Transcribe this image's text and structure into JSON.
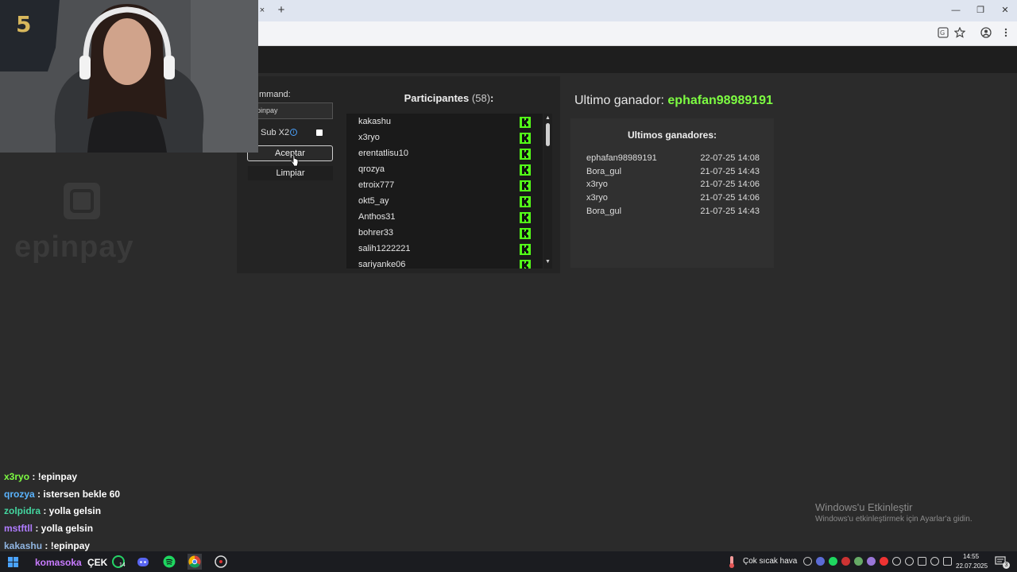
{
  "browser": {
    "tab_close": "×",
    "new_tab": "+",
    "window_controls": {
      "minimize": "—",
      "restore": "❐",
      "close": "✕"
    },
    "toolbar_icons": [
      "translate-icon",
      "star-icon",
      "profile-icon",
      "menu-icon"
    ]
  },
  "raffle": {
    "command_label": "mmand:",
    "command_value": "pinpay",
    "sub_label": "Sub X2",
    "sub_checked": false,
    "accept_label": "Aceptar",
    "clear_label": "Limpiar"
  },
  "participants": {
    "title": "Participantes",
    "count_text": "(58)",
    "colon": ":",
    "names": [
      "kakashu",
      "x3ryo",
      "erentatlisu10",
      "qrozya",
      "etroix777",
      "okt5_ay",
      "Anthos31",
      "bohrer33",
      "salih1222221",
      "sariyanke06"
    ],
    "badge_color": "#53fc18"
  },
  "winner": {
    "label": "Ultimo ganador:",
    "name": "ephafan98989191",
    "accent": "#7dfc42"
  },
  "winners": {
    "title": "Ultimos ganadores:",
    "rows": [
      {
        "name": "ephafan98989191",
        "date": "22-07-25 14:08"
      },
      {
        "name": "Bora_gul",
        "date": "21-07-25 14:43"
      },
      {
        "name": "x3ryo",
        "date": "21-07-25 14:06"
      },
      {
        "name": "x3ryo",
        "date": "21-07-25 14:06"
      },
      {
        "name": "Bora_gul",
        "date": "21-07-25 14:43"
      }
    ]
  },
  "overlay": {
    "watermark": "epinpay",
    "chat": [
      {
        "user": "x3ryo",
        "msg": " : !epinpay",
        "color": "#7dfc42"
      },
      {
        "user": "qrozya",
        "msg": " : istersen bekle 60",
        "color": "#5ab4ff"
      },
      {
        "user": "zolpidra",
        "msg": " : yolla gelsin",
        "color": "#44d6a0"
      },
      {
        "user": "mstftll",
        "msg": " : yolla gelsin",
        "color": "#b07cff"
      },
      {
        "user": "kakashu",
        "msg": " : !epinpay",
        "color": "#8fb4e0"
      }
    ],
    "ticker_user": "komasoka",
    "ticker_text": "ÇEK"
  },
  "windows": {
    "activate_title": "Windows'u Etkinleştir",
    "activate_sub": "Windows'u etkinleştirmek için Ayarlar'a gidin.",
    "weather": "Çok sıcak hava",
    "time": "14:55",
    "date": "22.07.2025",
    "notif_count": "3",
    "discord_badge": "14"
  }
}
